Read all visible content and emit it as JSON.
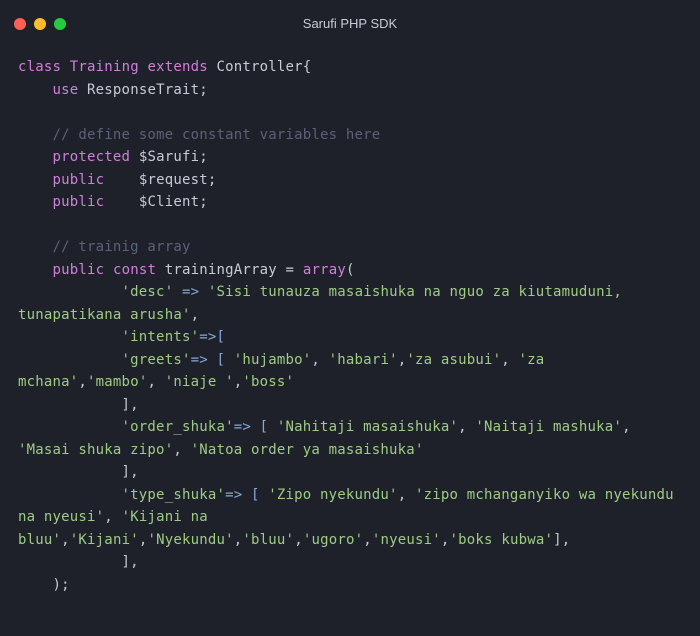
{
  "window": {
    "title": "Sarufi PHP SDK"
  },
  "code": {
    "kw_class": "class",
    "classname": "Training",
    "kw_extends": "extends",
    "parentname": "Controller{",
    "kw_use": "use",
    "usename": "ResponseTrait;",
    "comment1": "// define some constant variables here",
    "kw_protected": "protected",
    "var1": "$Sarufi;",
    "kw_public1": "public",
    "var2": "$request;",
    "kw_public2": "public",
    "var3": "$Client;",
    "comment2": "// trainig array",
    "kw_public3": "public",
    "kw_const": "const",
    "trainingArray": "trainingArray =",
    "kw_array": "array",
    "open_paren": "(",
    "key_desc": "'desc'",
    "arrow": "=>",
    "str_desc": "'Sisi tunauza masaishuka na nguo za kiutamuduni, tunapatikana arusha'",
    "comma": ",",
    "key_intents": "'intents'",
    "arrow_open": "=>[",
    "key_greets": "'greets'",
    "arrow_open2": "=> [",
    "greets_1": "'hujambo'",
    "greets_2": "'habari'",
    "greets_3": "'za asubui'",
    "greets_4": "'za mchana'",
    "greets_5": "'mambo'",
    "greets_6": "'niaje '",
    "greets_7": "'boss'",
    "close_bracket_comma": "],",
    "key_order": "'order_shuka'",
    "order_1": "'Nahitaji masaishuka'",
    "order_2": "'Naitaji mashuka'",
    "order_3": "'Masai shuka zipo'",
    "order_4": "'Natoa order ya masaishuka'",
    "key_type": "'type_shuka'",
    "type_1": "'Zipo nyekundu'",
    "type_2": "'zipo mchanganyiko wa nyekundu na nyeusi'",
    "type_3": "'Kijani na bluu'",
    "type_4": "'Kijani'",
    "type_5": "'Nyekundu'",
    "type_6": "'bluu'",
    "type_7": "'ugoro'",
    "type_8": "'nyeusi'",
    "type_9": "'boks kubwa'",
    "close_end": ");"
  }
}
